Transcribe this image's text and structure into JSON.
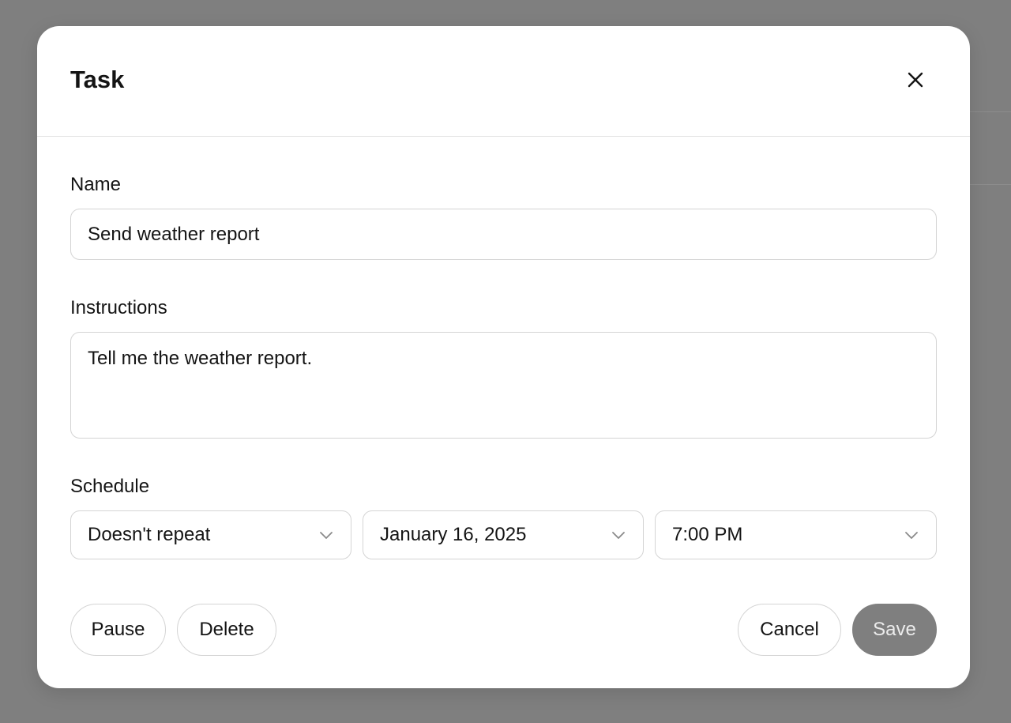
{
  "modal": {
    "title": "Task",
    "close_icon": "close-icon"
  },
  "form": {
    "name": {
      "label": "Name",
      "value": "Send weather report"
    },
    "instructions": {
      "label": "Instructions",
      "value": "Tell me the weather report."
    },
    "schedule": {
      "label": "Schedule",
      "repeat": "Doesn't repeat",
      "date": "January 16, 2025",
      "time": "7:00 PM",
      "dropdown_icon": "chevron-down-icon"
    }
  },
  "actions": {
    "pause_label": "Pause",
    "delete_label": "Delete",
    "cancel_label": "Cancel",
    "save_label": "Save"
  },
  "colors": {
    "overlay": "#7f7f7f",
    "save_button_bg": "#7f7f7f",
    "save_button_text": "#ececec"
  }
}
